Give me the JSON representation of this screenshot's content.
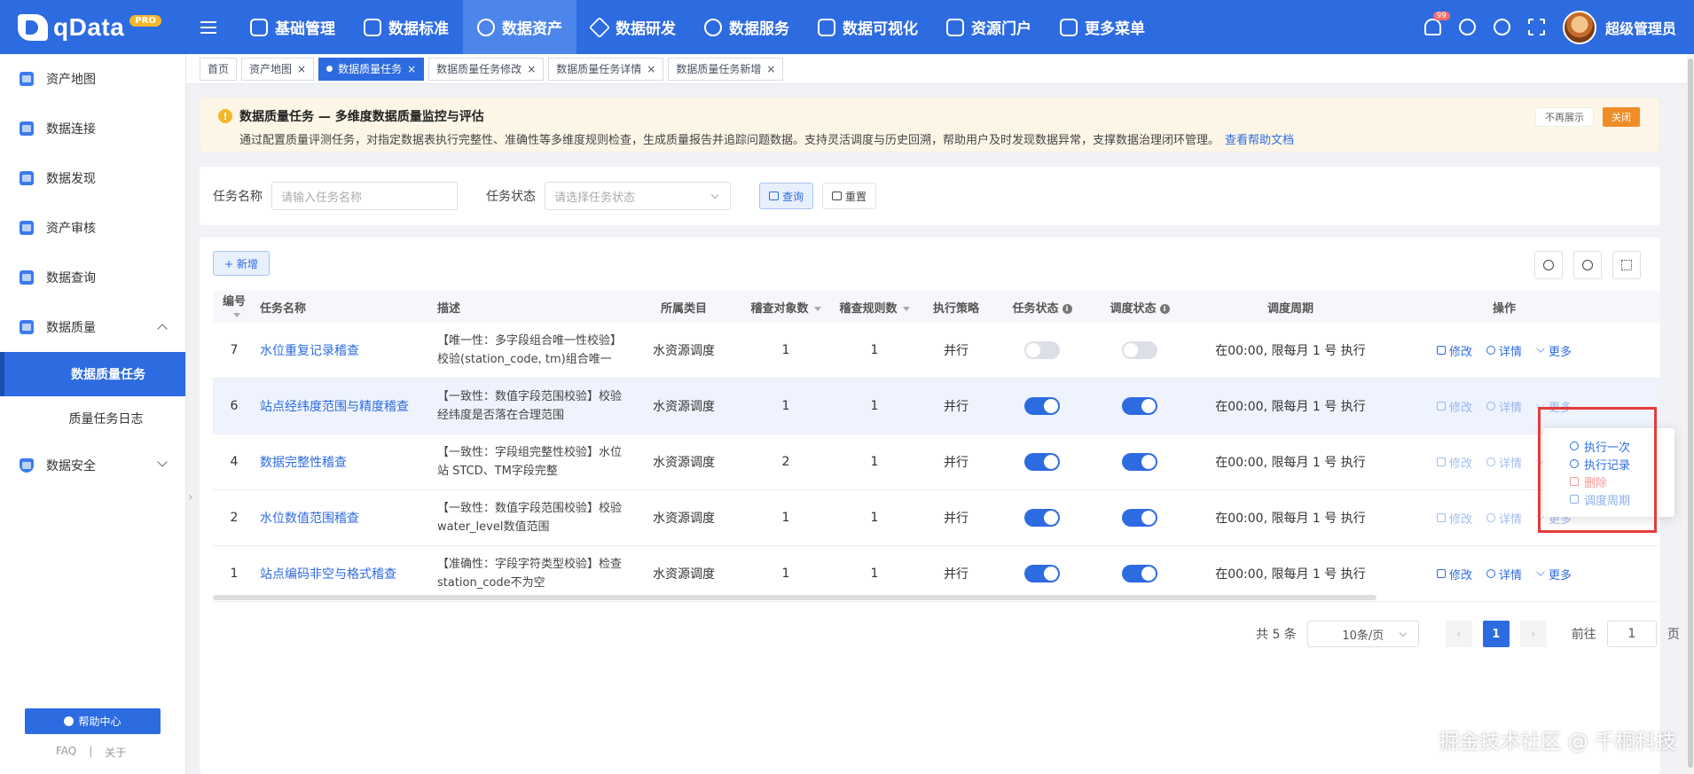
{
  "app": {
    "logo_text": "qData",
    "logo_badge": "PRO"
  },
  "topnav": [
    {
      "label": "基础管理",
      "icon": "cube-icon"
    },
    {
      "label": "数据标准",
      "icon": "book-icon"
    },
    {
      "label": "数据资产",
      "icon": "target-icon",
      "active": true
    },
    {
      "label": "数据研发",
      "icon": "hexagon-icon"
    },
    {
      "label": "数据服务",
      "icon": "gauge-icon"
    },
    {
      "label": "数据可视化",
      "icon": "chart-icon"
    },
    {
      "label": "资源门户",
      "icon": "portal-icon"
    },
    {
      "label": "更多菜单",
      "icon": "grid-icon"
    }
  ],
  "user": {
    "name": "超级管理员",
    "bell_badge": "99"
  },
  "sidebar": {
    "items": [
      {
        "label": "资产地图"
      },
      {
        "label": "数据连接"
      },
      {
        "label": "数据发现"
      },
      {
        "label": "资产审核"
      },
      {
        "label": "数据查询"
      },
      {
        "label": "数据质量"
      },
      {
        "label": "数据安全"
      }
    ],
    "sub_items": [
      {
        "label": "数据质量任务",
        "active": true
      },
      {
        "label": "质量任务日志"
      }
    ],
    "help_label": "帮助中心",
    "link_faq": "FAQ",
    "link_sep": "|",
    "link_about": "关于"
  },
  "tabs": [
    {
      "label": "首页"
    },
    {
      "label": "资产地图"
    },
    {
      "label": "数据质量任务",
      "active": true
    },
    {
      "label": "数据质量任务修改"
    },
    {
      "label": "数据质量任务详情"
    },
    {
      "label": "数据质量任务新增"
    }
  ],
  "notice": {
    "title": "数据质量任务 — 多维度数据质量监控与评估",
    "desc": "通过配置质量评测任务，对指定数据表执行完整性、准确性等多维度规则检查，生成质量报告并追踪问题数据。支持灵活调度与历史回溯，帮助用户及时发现数据异常，支撑数据治理闭环管理。",
    "link": "查看帮助文档",
    "btn_hide": "不再展示",
    "btn_close": "关闭"
  },
  "search": {
    "name_label": "任务名称",
    "name_placeholder": "请输入任务名称",
    "status_label": "任务状态",
    "status_placeholder": "请选择任务状态",
    "query_btn": "查询",
    "reset_btn": "重置"
  },
  "toolbar": {
    "add_btn": "+ 新增"
  },
  "table": {
    "headers": {
      "id": "编号",
      "name": "任务名称",
      "desc": "描述",
      "category": "所属类目",
      "obj_count": "稽查对象数",
      "rule_count": "稽查规则数",
      "strategy": "执行策略",
      "task_status": "任务状态",
      "sched_status": "调度状态",
      "cron": "调度周期",
      "ops": "操作"
    },
    "rows": [
      {
        "id": "7",
        "name": "水位重复记录稽查",
        "desc": "【唯一性：多字段组合唯一性校验】校验(station_code, tm)组合唯一",
        "category": "水资源调度",
        "obj": "1",
        "rule": "1",
        "strategy": "并行",
        "task_on": false,
        "sched_on": false,
        "cron": "在00:00, 限每月 1 号 执行"
      },
      {
        "id": "6",
        "name": "站点经纬度范围与精度稽查",
        "desc": "【一致性：数值字段范围校验】校验经纬度是否落在合理范围",
        "category": "水资源调度",
        "obj": "1",
        "rule": "1",
        "strategy": "并行",
        "task_on": true,
        "sched_on": true,
        "cron": "在00:00, 限每月 1 号 执行"
      },
      {
        "id": "4",
        "name": "数据完整性稽查",
        "desc": "【一致性：字段组完整性校验】水位站 STCD、TM字段完整",
        "category": "水资源调度",
        "obj": "2",
        "rule": "1",
        "strategy": "并行",
        "task_on": true,
        "sched_on": true,
        "cron": "在00:00, 限每月 1 号 执行"
      },
      {
        "id": "2",
        "name": "水位数值范围稽查",
        "desc": "【一致性：数值字段范围校验】校验water_level数值范围",
        "category": "水资源调度",
        "obj": "1",
        "rule": "1",
        "strategy": "并行",
        "task_on": true,
        "sched_on": true,
        "cron": "在00:00, 限每月 1 号 执行"
      },
      {
        "id": "1",
        "name": "站点编码非空与格式稽查",
        "desc": "【准确性：字段字符类型校验】检查station_code不为空",
        "category": "水资源调度",
        "obj": "1",
        "rule": "1",
        "strategy": "并行",
        "task_on": true,
        "sched_on": true,
        "cron": "在00:00, 限每月 1 号 执行"
      }
    ],
    "ops": {
      "edit": "修改",
      "detail": "详情",
      "more": "更多"
    }
  },
  "dropdown": {
    "run_once": "执行一次",
    "run_log": "执行记录",
    "delete": "删除",
    "schedule": "调度周期"
  },
  "pagination": {
    "total": "共 5 条",
    "page_size": "10条/页",
    "current": "1",
    "goto_label": "前往",
    "goto_value": "1",
    "page_suffix": "页"
  },
  "watermark": "掘金技术社区 @ 千桐科技"
}
